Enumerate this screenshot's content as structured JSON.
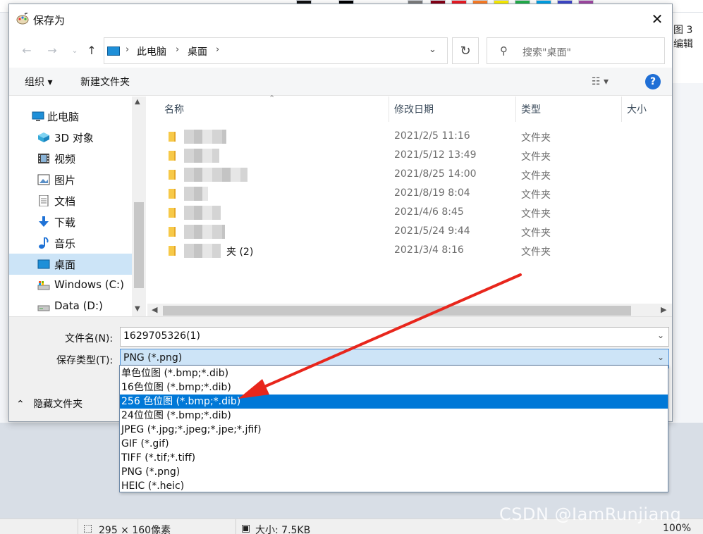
{
  "dialog": {
    "title": "保存为",
    "close_glyph": "✕"
  },
  "address": {
    "crumbs": [
      "此电脑",
      "桌面"
    ],
    "search_placeholder": "搜索\"桌面\""
  },
  "toolbar": {
    "organize": "组织 ▾",
    "new_folder": "新建文件夹",
    "help": "?"
  },
  "nav_pane": {
    "items": [
      {
        "label": "此电脑",
        "icon": "computer-icon"
      },
      {
        "label": "3D 对象",
        "icon": "3d-objects-icon"
      },
      {
        "label": "视频",
        "icon": "video-icon"
      },
      {
        "label": "图片",
        "icon": "pictures-icon"
      },
      {
        "label": "文档",
        "icon": "documents-icon"
      },
      {
        "label": "下载",
        "icon": "download-icon"
      },
      {
        "label": "音乐",
        "icon": "music-icon"
      },
      {
        "label": "桌面",
        "icon": "desktop-icon",
        "selected": true
      },
      {
        "label": "Windows (C:)",
        "icon": "drive-icon"
      },
      {
        "label": "Data (D:)",
        "icon": "drive-icon"
      }
    ]
  },
  "file_list": {
    "columns": [
      "名称",
      "修改日期",
      "类型",
      "大小"
    ],
    "rows": [
      {
        "name": "",
        "date": "2021/2/5 11:16",
        "type": "文件夹"
      },
      {
        "name": "",
        "date": "2021/5/12 13:49",
        "type": "文件夹"
      },
      {
        "name": "",
        "date": "2021/8/25 14:00",
        "type": "文件夹"
      },
      {
        "name": "",
        "date": "2021/8/19 8:04",
        "type": "文件夹"
      },
      {
        "name": "",
        "date": "2021/4/6 8:45",
        "type": "文件夹"
      },
      {
        "name": "",
        "date": "2021/5/24 9:44",
        "type": "文件夹"
      },
      {
        "name": "夹 (2)",
        "date": "2021/3/4 8:16",
        "type": "文件夹"
      }
    ]
  },
  "form": {
    "filename_label": "文件名(N):",
    "filename_value": "1629705326(1)",
    "type_label": "保存类型(T):",
    "type_value": "PNG (*.png)",
    "hide_folders": "隐藏文件夹"
  },
  "type_options": [
    {
      "label": "单色位图 (*.bmp;*.dib)"
    },
    {
      "label": "16色位图 (*.bmp;*.dib)"
    },
    {
      "label": "256 色位图 (*.bmp;*.dib)",
      "selected": true
    },
    {
      "label": "24位位图 (*.bmp;*.dib)"
    },
    {
      "label": "JPEG (*.jpg;*.jpeg;*.jpe;*.jfif)"
    },
    {
      "label": "GIF (*.gif)"
    },
    {
      "label": "TIFF (*.tif;*.tiff)"
    },
    {
      "label": "PNG (*.png)"
    },
    {
      "label": "HEIC (*.heic)"
    }
  ],
  "background_app": {
    "ribbon_right_1": "图 3",
    "ribbon_right_2": "编辑",
    "status_dimensions": "295 × 160像素",
    "status_size": "大小: 7.5KB",
    "status_zoom": "100%",
    "watermark": "CSDN @IamRunjiang"
  },
  "colors": {
    "accent": "#0078d7",
    "annotation_arrow": "#e8261c"
  }
}
